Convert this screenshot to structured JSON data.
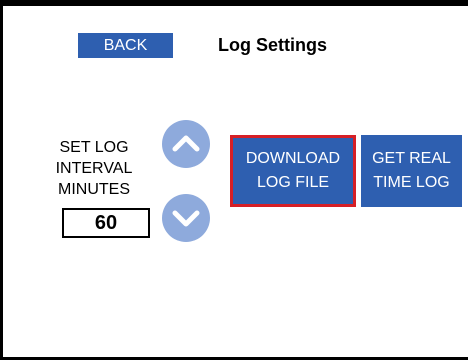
{
  "header": {
    "back_label": "BACK",
    "title": "Log Settings"
  },
  "interval": {
    "label_lines": [
      "SET LOG",
      "INTERVAL",
      "MINUTES"
    ],
    "value": "60",
    "up_icon": "chevron-up-icon",
    "down_icon": "chevron-down-icon"
  },
  "actions": {
    "download": {
      "lines": [
        "DOWNLOAD",
        "LOG FILE"
      ]
    },
    "realtime": {
      "lines": [
        "GET REAL",
        "TIME LOG"
      ]
    }
  },
  "colors": {
    "button_blue": "#2e5fb0",
    "stepper_blue": "#8eaadc",
    "selected_border": "#d61f26"
  }
}
